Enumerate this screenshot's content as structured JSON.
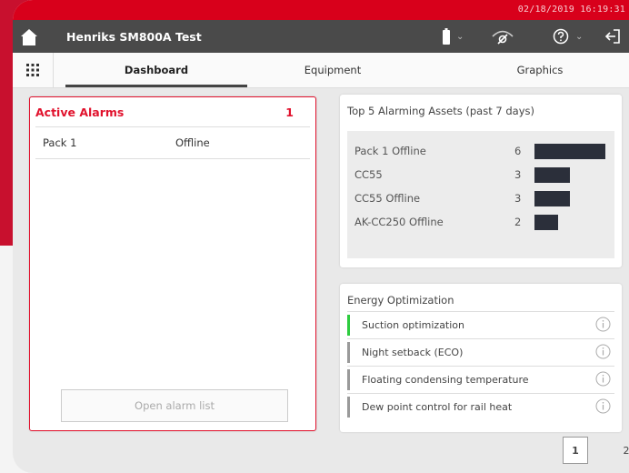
{
  "statusbar": {
    "datetime": "02/18/2019 16:19:31"
  },
  "header": {
    "title": "Henriks SM800A Test"
  },
  "tabs": [
    {
      "label": "Dashboard",
      "active": true
    },
    {
      "label": "Equipment",
      "active": false
    },
    {
      "label": "Graphics",
      "active": false
    }
  ],
  "alarms": {
    "title": "Active Alarms",
    "count": "1",
    "rows": [
      {
        "name": "Pack 1",
        "status": "Offline"
      }
    ],
    "open_button": "Open alarm list"
  },
  "top5": {
    "title": "Top 5 Alarming Assets (past 7 days)",
    "assets": [
      {
        "name": "Pack 1 Offline",
        "count": "6",
        "value": 6
      },
      {
        "name": "CC55",
        "count": "3",
        "value": 3
      },
      {
        "name": "CC55 Offline",
        "count": "3",
        "value": 3
      },
      {
        "name": "AK-CC250 Offline",
        "count": "2",
        "value": 2
      }
    ]
  },
  "energy": {
    "title": "Energy Optimization",
    "items": [
      {
        "label": "Suction optimization",
        "status_color": "#2ecc40"
      },
      {
        "label": "Night setback (ECO)",
        "status_color": "#9a9a9a"
      },
      {
        "label": "Floating condensing temperature",
        "status_color": "#9a9a9a"
      },
      {
        "label": "Dew point control for rail heat",
        "status_color": "#9a9a9a"
      }
    ]
  },
  "pagination": {
    "current": "1",
    "next": "2"
  },
  "colors": {
    "status_bar": "#d8001b",
    "accent_red": "#e1122d",
    "title_bar": "#4a4a4a"
  },
  "icons": [
    "home-icon",
    "battery-icon",
    "signal-icon",
    "help-icon",
    "logout-icon",
    "apps-grid-icon",
    "info-icon"
  ]
}
